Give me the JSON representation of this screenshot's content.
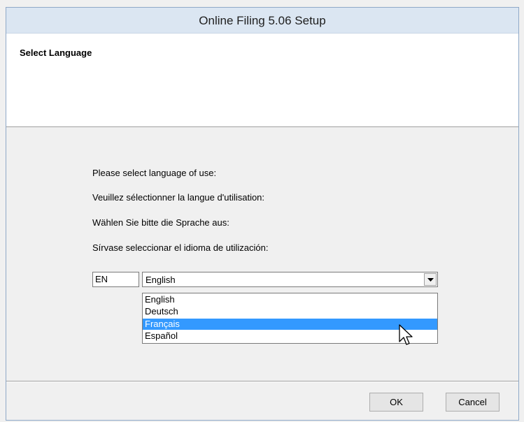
{
  "window": {
    "title": "Online Filing 5.06 Setup"
  },
  "header": {
    "title": "Select Language"
  },
  "prompts": [
    "Please select language of use:",
    "Veuillez sélectionner la langue d'utilisation:",
    "Wählen Sie bitte die Sprache aus:",
    "Sírvase seleccionar el idioma de utilización:"
  ],
  "language_code": "EN",
  "language_select": {
    "value": "English",
    "options": [
      "English",
      "Deutsch",
      "Français",
      "Español"
    ],
    "highlighted_index": 2
  },
  "buttons": {
    "ok_label": "OK",
    "cancel_label": "Cancel"
  },
  "icons": {
    "combo_arrow": "chevron-down-icon",
    "cursor": "mouse-pointer-icon"
  },
  "colors": {
    "highlight": "#3399ff",
    "titlebar": "#dbe6f2"
  }
}
